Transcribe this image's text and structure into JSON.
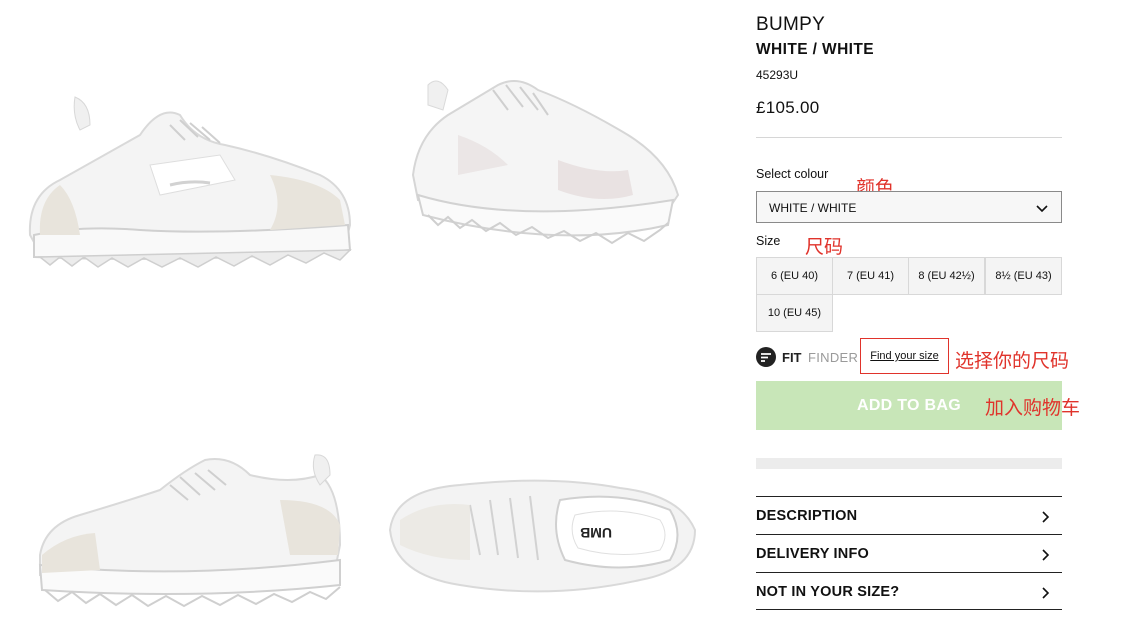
{
  "product": {
    "name": "BUMPY",
    "colourway": "WHITE / WHITE",
    "sku": "45293U",
    "price": "£105.00"
  },
  "colour": {
    "label": "Select colour",
    "selected": "WHITE / WHITE"
  },
  "size": {
    "label": "Size",
    "options": [
      "6 (EU 40)",
      "7 (EU 41)",
      "8 (EU 42½)",
      "8½ (EU 43)",
      "10 (EU 45)"
    ]
  },
  "fit_finder": {
    "fit": "FIT",
    "finder": "FINDER",
    "link": "Find your size"
  },
  "cta": {
    "add_to_bag": "ADD TO BAG"
  },
  "accordion": [
    "DESCRIPTION",
    "DELIVERY INFO",
    "NOT IN YOUR SIZE?"
  ],
  "annotations": {
    "colour": "颜色",
    "size": "尺码",
    "find_size": "选择你的尺码",
    "add_to_bag": "加入购物车"
  },
  "colors": {
    "accent_cta": "#c8e6b8",
    "annotation": "#e0332b"
  },
  "icons": [
    "chevron-down-icon",
    "fit-finder-logo-icon",
    "chevron-right-icon"
  ]
}
